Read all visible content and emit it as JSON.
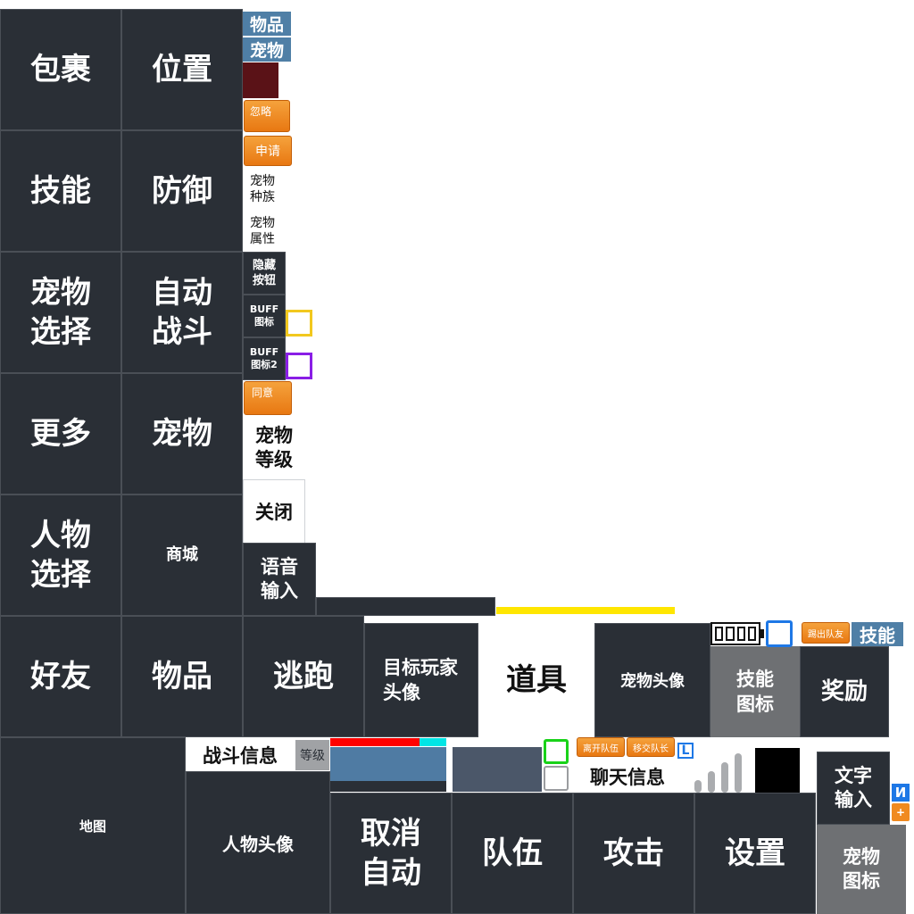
{
  "grid": {
    "bag": "包裹",
    "position": "位置",
    "skill": "技能",
    "defense": "防御",
    "pet_select": "宠物\n选择",
    "auto_battle": "自动\n战斗",
    "more": "更多",
    "pet": "宠物",
    "char_select": "人物\n选择",
    "shop": "商城",
    "friends": "好友",
    "items": "物品",
    "escape": "逃跑",
    "target_avatar": "目标玩家\n头像",
    "props": "道具",
    "pet_avatar": "宠物头像",
    "skill_icon": "技能\n图标",
    "reward": "奖励",
    "map": "地图",
    "char_avatar": "人物头像",
    "cancel_auto": "取消\n自动",
    "team": "队伍",
    "attack": "攻击",
    "settings": "设置",
    "text_input": "文字\n输入",
    "pet_icon": "宠物\n图标"
  },
  "side": {
    "items_tab": "物品",
    "pet_tab": "宠物",
    "ignore": "忽略",
    "apply": "申请",
    "pet_race": "宠物\n种族",
    "pet_attr": "宠物\n属性",
    "hide_button": "隐藏\n按钮",
    "buff_icon": "BUFF\n图标",
    "buff_icon2": "BUFF\n图标2",
    "agree": "同意",
    "pet_level": "宠物\n等级",
    "close": "关闭",
    "voice_input": "语音\n输入"
  },
  "team_bar": {
    "kick": "踢出队友",
    "skill_tab": "技能",
    "leave_team": "离开队伍",
    "transfer_leader": "移交队长",
    "l_badge": "L"
  },
  "battle": {
    "battle_info": "战斗信息",
    "level_badge": "等级",
    "chat_info": "聊天信息"
  },
  "misc": {
    "input_method": "И",
    "plus": "+"
  },
  "colors": {
    "tile_bg": "#2a2f36",
    "hp_bar": "#ff0000",
    "mp_bar": "#00e5e5",
    "exp_bar": "#ffe600",
    "yellow_frame": "#f2c81e",
    "purple_frame": "#8a1ee6",
    "green_frame": "#19d219",
    "blue_frame": "#1e78e6"
  }
}
